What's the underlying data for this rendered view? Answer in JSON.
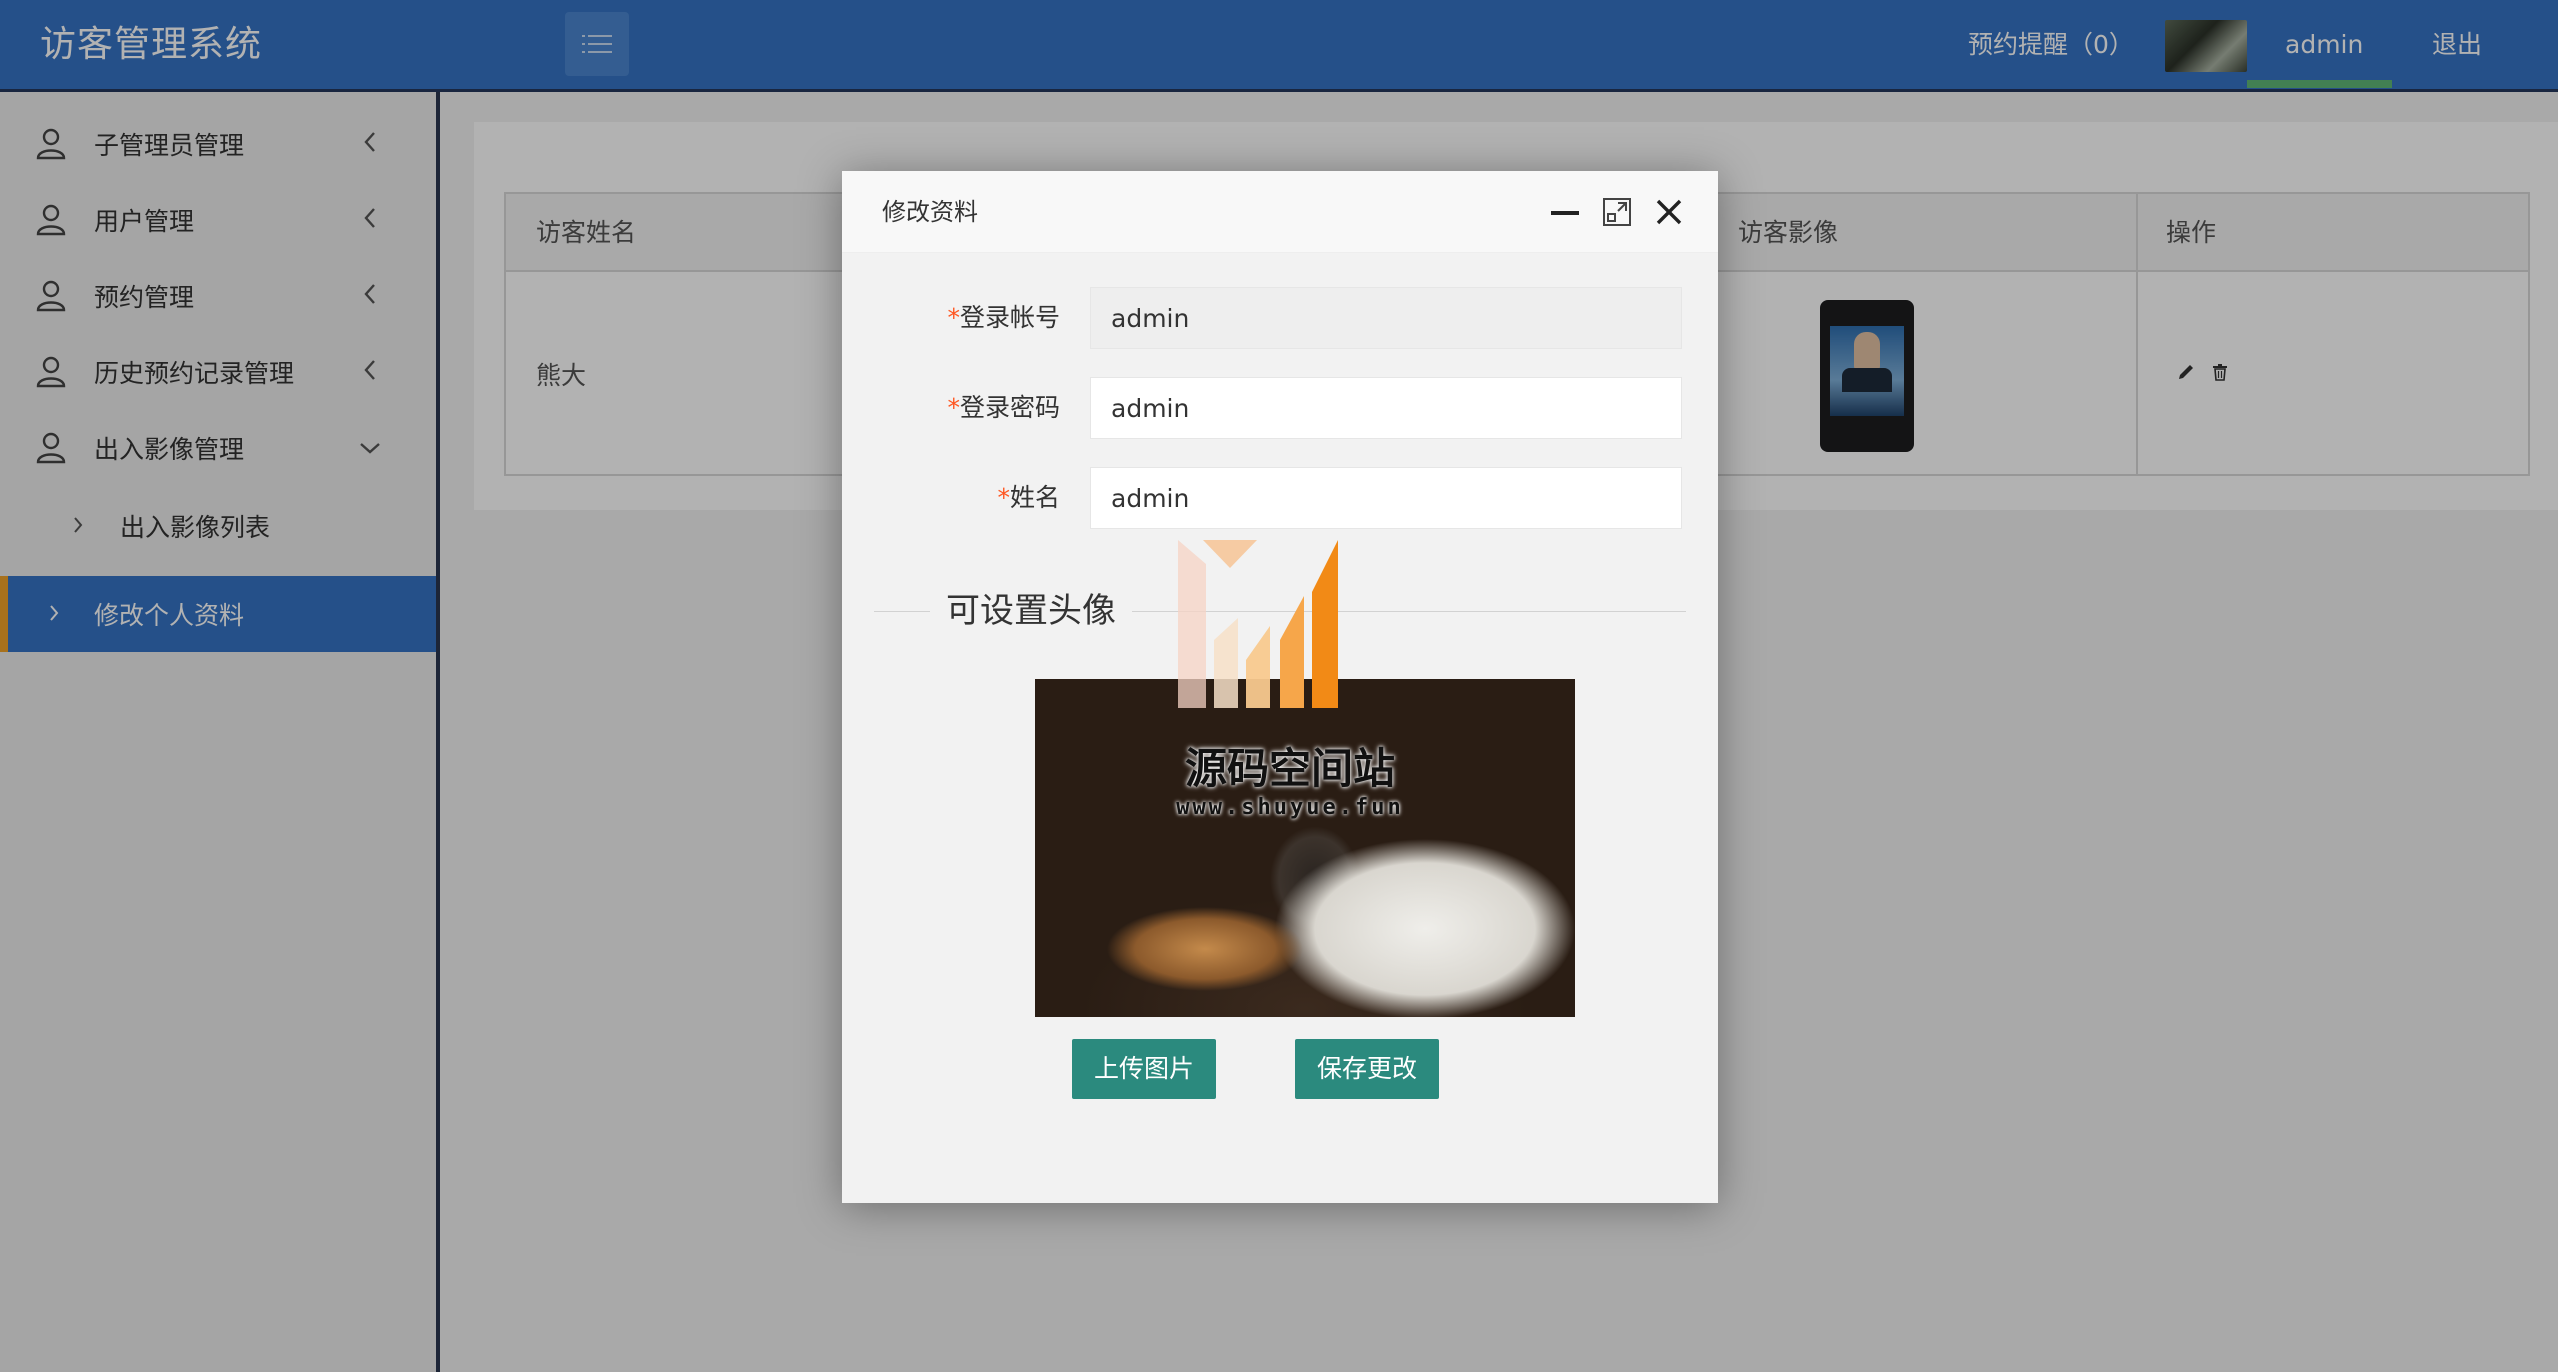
{
  "app": {
    "title": "访客管理系统"
  },
  "header": {
    "reminder_label": "预约提醒（0）",
    "user_name": "admin",
    "logout_label": "退出"
  },
  "sidebar": {
    "items": [
      {
        "label": "子管理员管理",
        "icon": "user-icon",
        "expanded": false
      },
      {
        "label": "用户管理",
        "icon": "user-icon",
        "expanded": false
      },
      {
        "label": "预约管理",
        "icon": "user-icon",
        "expanded": false
      },
      {
        "label": "历史预约记录管理",
        "icon": "user-icon",
        "expanded": false
      },
      {
        "label": "出入影像管理",
        "icon": "user-icon",
        "expanded": true
      }
    ],
    "sub_items": [
      {
        "label": "出入影像列表"
      }
    ],
    "active_item": {
      "label": "修改个人资料"
    }
  },
  "table": {
    "headers": [
      "访客姓名",
      "访客影像",
      "操作"
    ],
    "rows": [
      {
        "name": "熊大"
      }
    ]
  },
  "modal": {
    "title": "修改资料",
    "fields": [
      {
        "label": "登录帐号",
        "value": "admin",
        "readonly": true
      },
      {
        "label": "登录密码",
        "value": "admin",
        "readonly": false
      },
      {
        "label": "姓名",
        "value": "admin",
        "readonly": false
      }
    ],
    "avatar_legend": "可设置头像",
    "upload_label": "上传图片",
    "save_label": "保存更改"
  },
  "watermark": {
    "name": "源码空间站",
    "url": "www.shuyue.fun"
  },
  "colors": {
    "header_bg": "#3573c4",
    "active_nav_bg": "#3573c4",
    "active_nav_accent": "#f0a22a",
    "primary_button": "#2b8a7e",
    "required_mark": "#ff5722",
    "admin_underline": "#5fb878"
  }
}
